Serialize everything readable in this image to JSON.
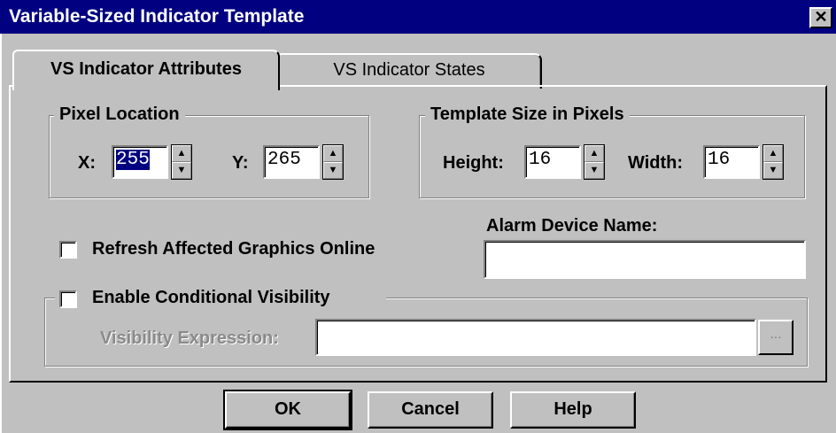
{
  "window": {
    "title": "Variable-Sized Indicator Template",
    "close_glyph": "✕"
  },
  "tabs": [
    {
      "label": "VS Indicator Attributes",
      "active": true
    },
    {
      "label": "VS Indicator States",
      "active": false
    }
  ],
  "pixel_location": {
    "legend": "Pixel Location",
    "x_label": "X:",
    "x_value": "255",
    "y_label": "Y:",
    "y_value": "265"
  },
  "template_size": {
    "legend": "Template Size in Pixels",
    "height_label": "Height:",
    "height_value": "16",
    "width_label": "Width:",
    "width_value": "16"
  },
  "refresh": {
    "label": "Refresh Affected Graphics Online",
    "checked": false
  },
  "alarm": {
    "label": "Alarm Device Name:",
    "value": ""
  },
  "visibility": {
    "checkbox_label": "Enable Conditional Visibility",
    "checked": false,
    "expression_label": "Visibility Expression:",
    "expression_value": "",
    "browse_label": "..."
  },
  "buttons": {
    "ok": "OK",
    "cancel": "Cancel",
    "help": "Help"
  },
  "icons": {
    "spin_up": "▲",
    "spin_down": "▼"
  }
}
